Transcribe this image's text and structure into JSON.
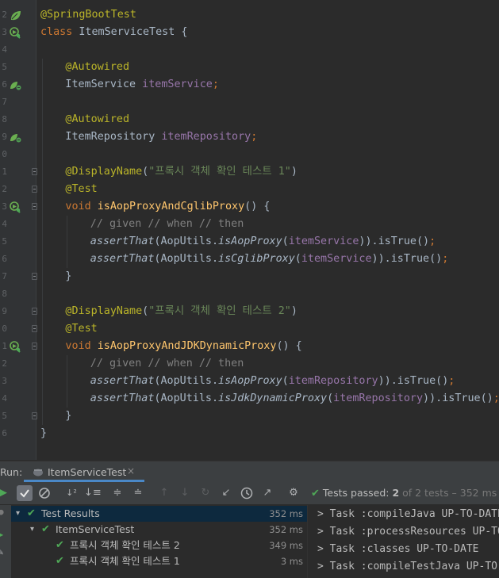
{
  "editor": {
    "lines": [
      {
        "num": "2",
        "icon": "spring-bean-icon",
        "fold": false
      },
      {
        "num": "3",
        "icon": "run-test-icon",
        "fold": false
      },
      {
        "num": "4",
        "icon": "",
        "fold": false
      },
      {
        "num": "5",
        "icon": "",
        "fold": false
      },
      {
        "num": "6",
        "icon": "autowired-bean-icon",
        "fold": false
      },
      {
        "num": "7",
        "icon": "",
        "fold": false
      },
      {
        "num": "8",
        "icon": "",
        "fold": false
      },
      {
        "num": "9",
        "icon": "autowired-bean-icon",
        "fold": false
      },
      {
        "num": "0",
        "icon": "",
        "fold": false
      },
      {
        "num": "1",
        "icon": "",
        "fold": true
      },
      {
        "num": "2",
        "icon": "",
        "fold": true
      },
      {
        "num": "3",
        "icon": "run-test-icon",
        "fold": true
      },
      {
        "num": "4",
        "icon": "",
        "fold": false
      },
      {
        "num": "5",
        "icon": "",
        "fold": false
      },
      {
        "num": "6",
        "icon": "",
        "fold": false
      },
      {
        "num": "7",
        "icon": "",
        "fold": true
      },
      {
        "num": "8",
        "icon": "",
        "fold": false
      },
      {
        "num": "9",
        "icon": "",
        "fold": true
      },
      {
        "num": "0",
        "icon": "",
        "fold": true
      },
      {
        "num": "1",
        "icon": "run-test-icon",
        "fold": true
      },
      {
        "num": "2",
        "icon": "",
        "fold": false
      },
      {
        "num": "3",
        "icon": "",
        "fold": false
      },
      {
        "num": "4",
        "icon": "",
        "fold": false
      },
      {
        "num": "5",
        "icon": "",
        "fold": true
      },
      {
        "num": "6",
        "icon": "",
        "fold": false
      }
    ],
    "code": {
      "l0_ann": "@SpringBootTest",
      "l1_kw": "class ",
      "l1_name": "ItemServiceTest {",
      "l3_ann": "@Autowired",
      "l4_type": "ItemService ",
      "l4_field": "itemService",
      "l4_semi": ";",
      "l6_ann": "@Autowired",
      "l7_type": "ItemRepository ",
      "l7_field": "itemRepository",
      "l7_semi": ";",
      "l9_ann": "@DisplayName",
      "l9_open": "(",
      "l9_str": "\"프록시 객체 확인 테스트 1\"",
      "l9_close": ")",
      "l10_ann": "@Test",
      "l11_kw": "void ",
      "l11_fn": "isAopProxyAndCglibProxy",
      "l11_rest": "() {",
      "l12_cmt": "// given // when // then",
      "l13_a": "assertThat",
      "l13_b": "(AopUtils.",
      "l13_c": "isAopProxy",
      "l13_d": "(",
      "l13_e": "itemService",
      "l13_f": ")).isTrue()",
      "l13_g": ";",
      "l14_a": "assertThat",
      "l14_b": "(AopUtils.",
      "l14_c": "isCglibProxy",
      "l14_d": "(",
      "l14_e": "itemService",
      "l14_f": ")).isTrue()",
      "l14_g": ";",
      "l15_brace": "}",
      "l17_ann": "@DisplayName",
      "l17_open": "(",
      "l17_str": "\"프록시 객체 확인 테스트 2\"",
      "l17_close": ")",
      "l18_ann": "@Test",
      "l19_kw": "void ",
      "l19_fn": "isAopProxyAndJDKDynamicProxy",
      "l19_rest": "() {",
      "l20_cmt": "// given // when // then",
      "l21_a": "assertThat",
      "l21_b": "(AopUtils.",
      "l21_c": "isAopProxy",
      "l21_d": "(",
      "l21_e": "itemRepository",
      "l21_f": ")).isTrue()",
      "l21_g": ";",
      "l22_a": "assertThat",
      "l22_b": "(AopUtils.",
      "l22_c": "isJdkDynamicProxy",
      "l22_d": "(",
      "l22_e": "itemRepository",
      "l22_f": ")).isTrue()",
      "l22_g": ";",
      "l23_brace": "}",
      "l24_brace": "}"
    }
  },
  "run_panel": {
    "label": "Run:",
    "tab_name": "ItemServiceTest",
    "tab_close": "×",
    "status_prefix": "Tests passed: ",
    "status_passed": "2",
    "status_suffix": " of 2 tests – 352 ms",
    "tree": [
      {
        "label": "Test Results",
        "time": "352 ms",
        "indent": 0,
        "arrow": true,
        "selected": true
      },
      {
        "label": "ItemServiceTest",
        "time": "352 ms",
        "indent": 1,
        "arrow": true,
        "selected": false
      },
      {
        "label": "프록시 객체 확인 테스트 2",
        "time": "349 ms",
        "indent": 2,
        "arrow": false,
        "selected": false
      },
      {
        "label": "프록시 객체 확인 테스트 1",
        "time": "3 ms",
        "indent": 2,
        "arrow": false,
        "selected": false
      }
    ],
    "console": [
      "> Task :compileJava UP-TO-DATE",
      "> Task :processResources UP-TO-DATE",
      "> Task :classes UP-TO-DATE",
      "> Task :compileTestJava UP-TO-DATE"
    ]
  },
  "colors": {
    "pass_green": "#4fa857",
    "spring_green": "#6aaf50",
    "selection": "#0d293e",
    "accent": "#4a88c7"
  }
}
